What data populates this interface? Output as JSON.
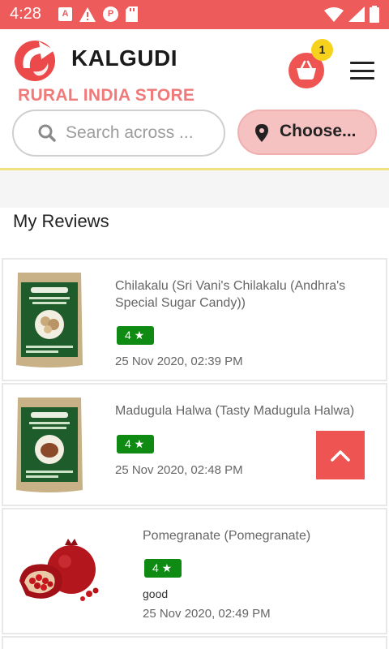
{
  "status_bar": {
    "time": "4:28",
    "icons": [
      "a-notification-icon",
      "warning-icon",
      "p-notification-icon",
      "sd-card-icon",
      "wifi-icon",
      "signal-icon",
      "battery-icon"
    ]
  },
  "header": {
    "brand_name": "KALGUDI",
    "brand_subtitle": "RURAL INDIA STORE",
    "cart_count": "1",
    "search_placeholder": "Search across ...",
    "location_label": "Choose..."
  },
  "reviews": {
    "title": "My Reviews",
    "items": [
      {
        "name": "Chilakalu (Sri Vani's Chilakalu (Andhra's Special Sugar Candy))",
        "rating": "4 ★",
        "comment": "",
        "date": "25 Nov 2020, 02:39 PM"
      },
      {
        "name": "Madugula Halwa (Tasty Madugula Halwa)",
        "rating": "4 ★",
        "comment": "",
        "date": "25 Nov 2020, 02:48 PM"
      },
      {
        "name": "Pomegranate (Pomegranate)",
        "rating": "4 ★",
        "comment": "good",
        "date": "25 Nov 2020, 02:49 PM"
      }
    ]
  },
  "colors": {
    "brand_red": "#ee5b5b",
    "badge_yellow": "#f7d21d",
    "rating_green": "#0f8a13",
    "location_pink": "#f6c1c1"
  }
}
